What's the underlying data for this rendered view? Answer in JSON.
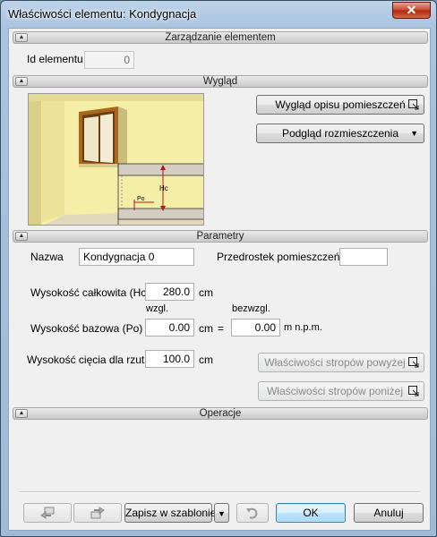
{
  "window": {
    "title": "Właściwości elementu: Kondygnacja",
    "close_glyph": "✕"
  },
  "sections": {
    "management": "Zarządzanie elementem",
    "appearance": "Wygląd",
    "parameters": "Parametry",
    "operations": "Operacje"
  },
  "management": {
    "id_label": "Id elementu",
    "id_value": "0"
  },
  "appearance": {
    "room_desc_button": "Wygląd opisu pomieszczeń",
    "layout_preview_button": "Podgląd rozmieszczenia",
    "diagram_hc": "Hc",
    "diagram_po": "Po"
  },
  "parameters": {
    "name_label": "Nazwa",
    "name_value": "Kondygnacja 0",
    "room_prefix_label": "Przedrostek pomieszczeń",
    "room_prefix_value": "",
    "total_height_label": "Wysokość całkowita (Hc)",
    "total_height_value": "280.0",
    "total_height_unit": "cm",
    "relative_label": "wzgl.",
    "absolute_label": "bezwzgl.",
    "base_height_label": "Wysokość bazowa (Po)",
    "base_height_value": "0.00",
    "base_height_unit": "cm",
    "equals": "=",
    "absolute_value": "0.00",
    "absolute_unit": "m n.p.m.",
    "cut_height_label": "Wysokość cięcia dla rzutu",
    "cut_height_value": "100.0",
    "cut_height_unit": "cm",
    "ceiling_above_button": "Właściwości stropów powyżej",
    "ceiling_below_button": "Właściwości stropów poniżej"
  },
  "footer": {
    "save_template_button": "Zapisz w szablonie",
    "ok_button": "OK",
    "cancel_button": "Anuluj"
  },
  "colors": {
    "accent": "#3c7fb1",
    "preview_wall": "#f7f2b2"
  }
}
